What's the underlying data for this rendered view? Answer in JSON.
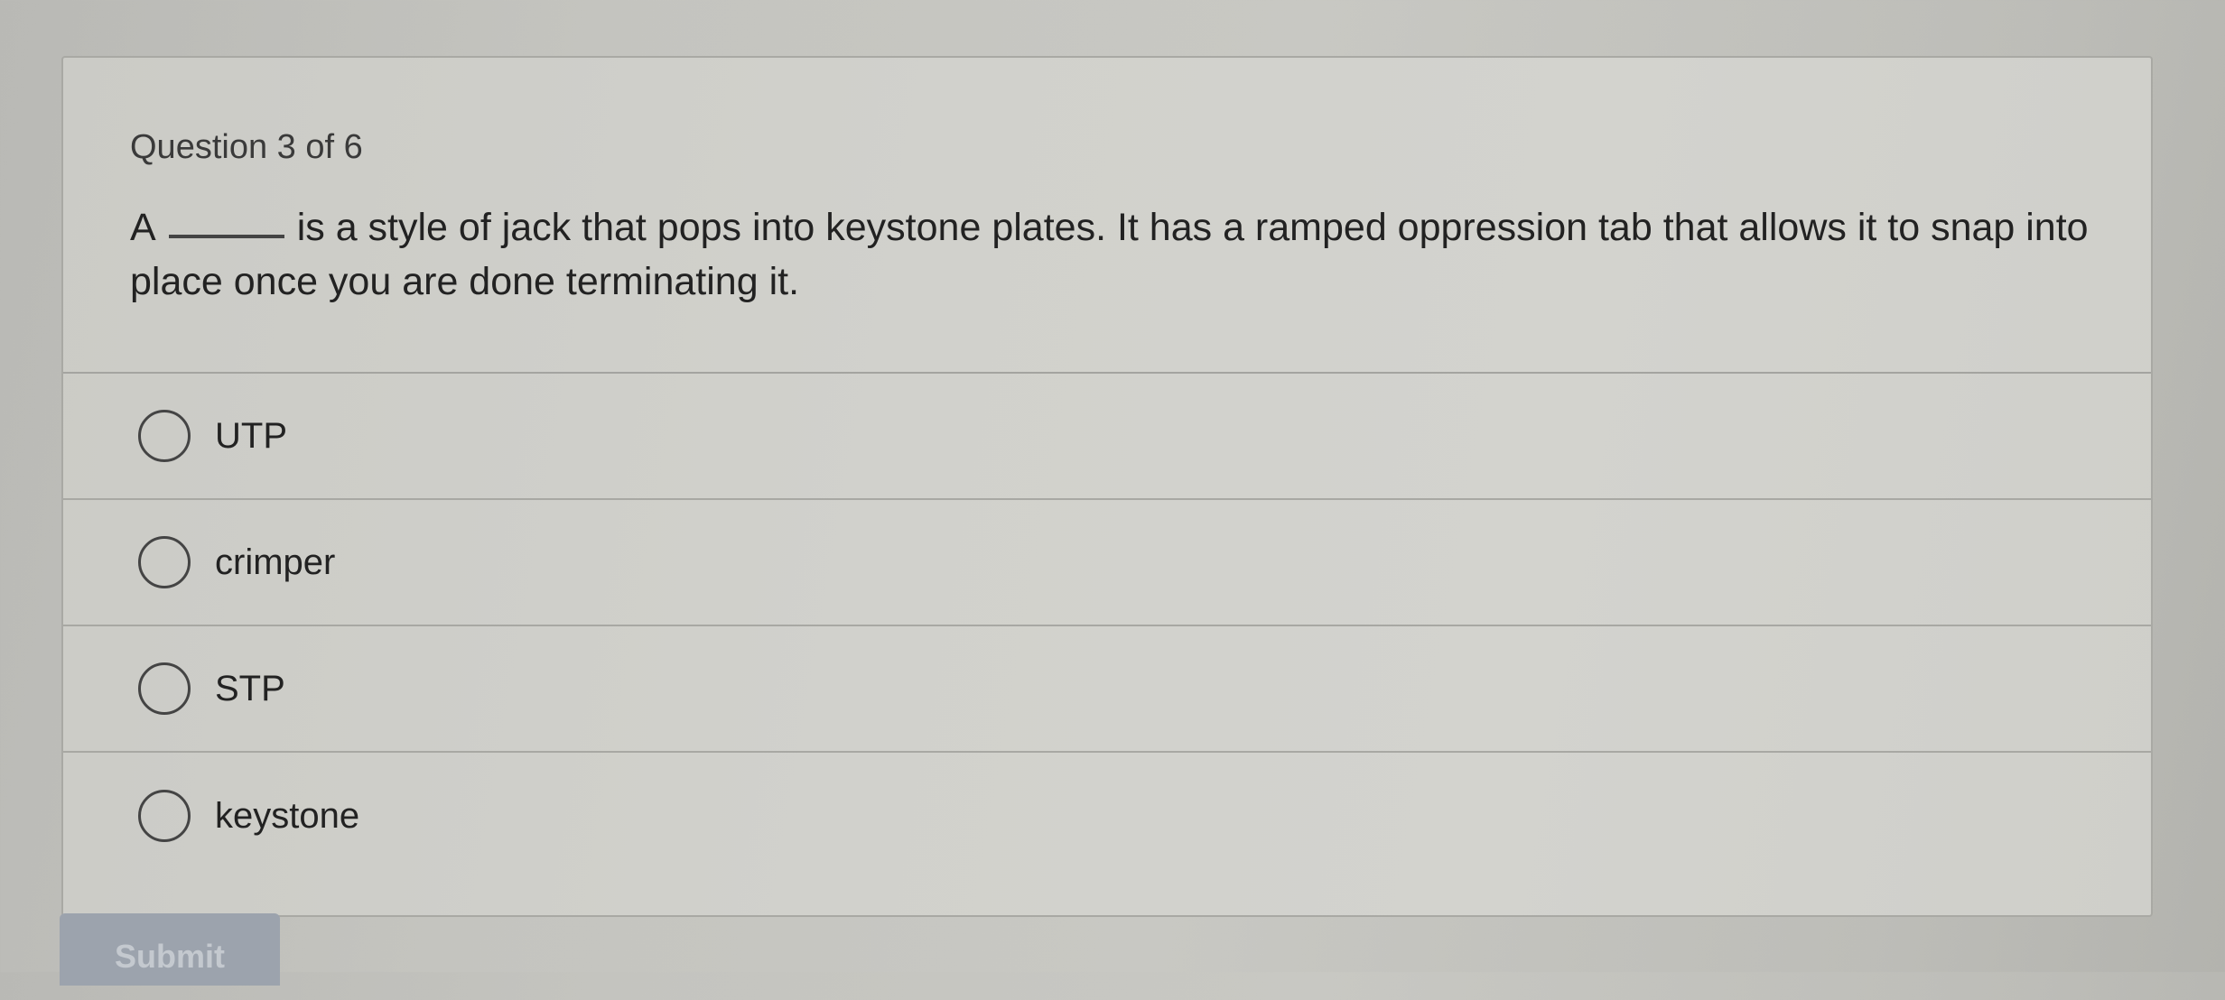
{
  "quiz": {
    "counter": "Question 3 of 6",
    "question_prefix": "A",
    "question_rest": "is a style of jack that pops into keystone plates. It has a ramped oppression tab that allows it to snap into place once you are done terminating it.",
    "options": [
      {
        "label": "UTP"
      },
      {
        "label": "crimper"
      },
      {
        "label": "STP"
      },
      {
        "label": "keystone"
      }
    ],
    "submit_label": "Submit"
  }
}
